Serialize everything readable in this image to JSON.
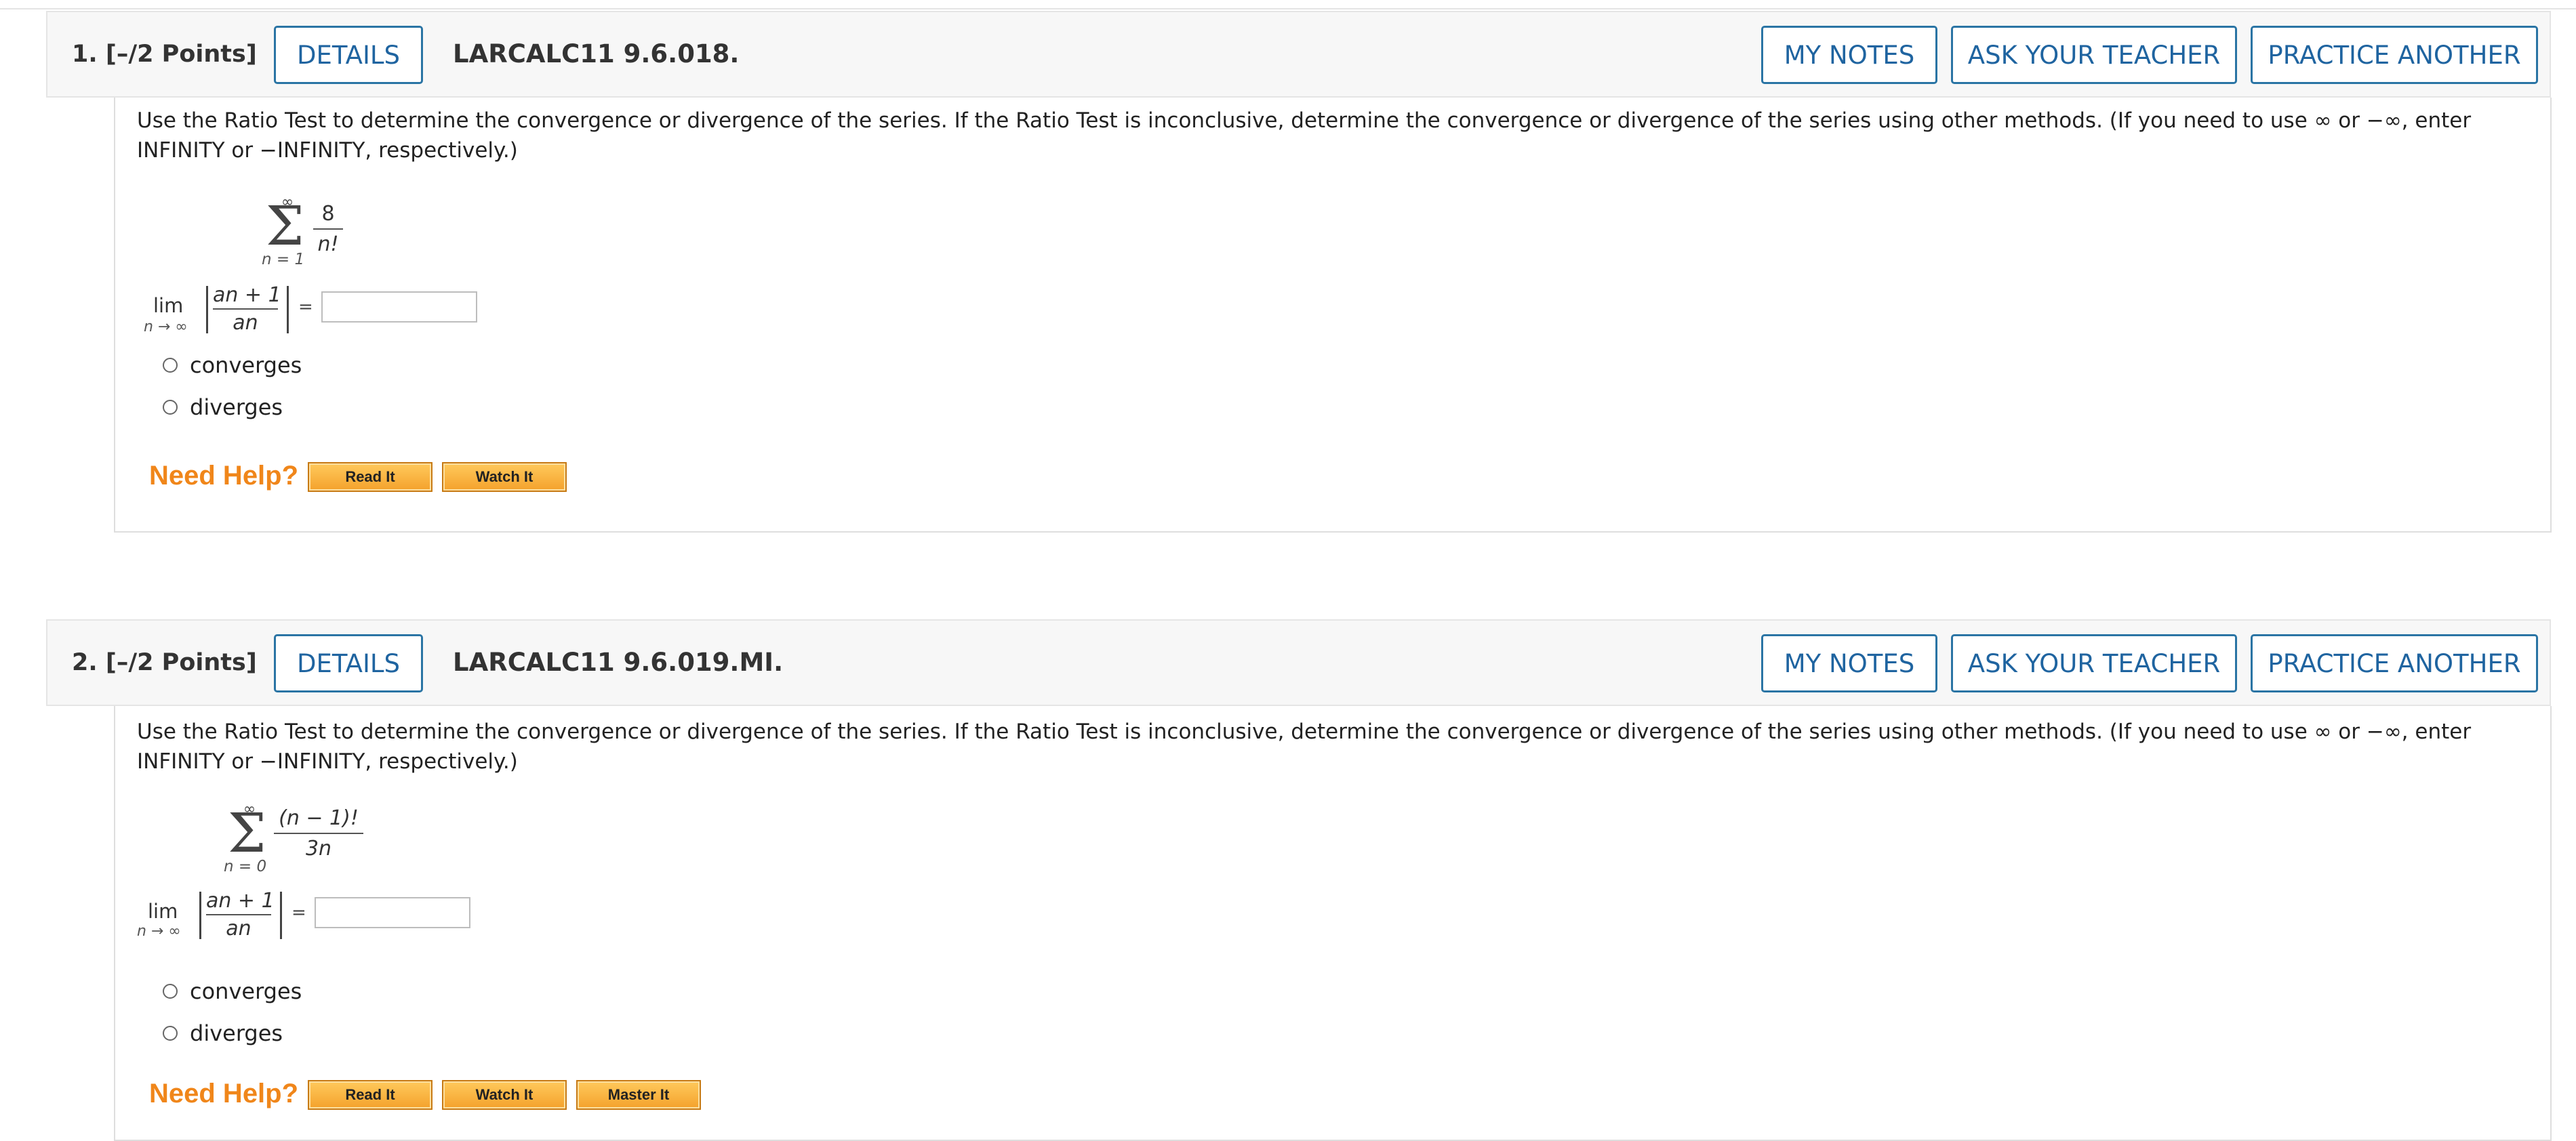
{
  "questions": [
    {
      "number": "1.",
      "points": "[–/2 Points]",
      "details_label": "DETAILS",
      "code": "LARCALC11 9.6.018.",
      "my_notes_label": "MY NOTES",
      "ask_teacher_label": "ASK YOUR TEACHER",
      "practice_label": "PRACTICE ANOTHER",
      "prompt": "Use the Ratio Test to determine the convergence or divergence of the series. If the Ratio Test is inconclusive, determine the convergence or divergence of the series using other methods. (If you need to use ∞ or −∞, enter INFINITY or −INFINITY, respectively.)",
      "series": {
        "upper": "∞",
        "lower": "n = 1",
        "numerator": "8",
        "denominator": "n!"
      },
      "limit": {
        "lim": "lim",
        "under": "n → ∞",
        "ratio_num": "an + 1",
        "ratio_den": "an",
        "equals": "="
      },
      "answer_value": "",
      "options": [
        "converges",
        "diverges"
      ],
      "need_help": "Need Help?",
      "help_buttons": [
        "Read It",
        "Watch It"
      ]
    },
    {
      "number": "2.",
      "points": "[–/2 Points]",
      "details_label": "DETAILS",
      "code": "LARCALC11 9.6.019.MI.",
      "my_notes_label": "MY NOTES",
      "ask_teacher_label": "ASK YOUR TEACHER",
      "practice_label": "PRACTICE ANOTHER",
      "prompt": "Use the Ratio Test to determine the convergence or divergence of the series. If the Ratio Test is inconclusive, determine the convergence or divergence of the series using other methods. (If you need to use ∞ or −∞, enter INFINITY or −INFINITY, respectively.)",
      "series": {
        "upper": "∞",
        "lower": "n = 0",
        "numerator": "(n − 1)!",
        "denominator": "3n"
      },
      "limit": {
        "lim": "lim",
        "under": "n → ∞",
        "ratio_num": "an + 1",
        "ratio_den": "an",
        "equals": "="
      },
      "answer_value": "",
      "options": [
        "converges",
        "diverges"
      ],
      "need_help": "Need Help?",
      "help_buttons": [
        "Read It",
        "Watch It",
        "Master It"
      ]
    }
  ],
  "colors": {
    "accent": "#1f64a0",
    "help": "#f0861a",
    "variable_highlight": "#d40000"
  }
}
